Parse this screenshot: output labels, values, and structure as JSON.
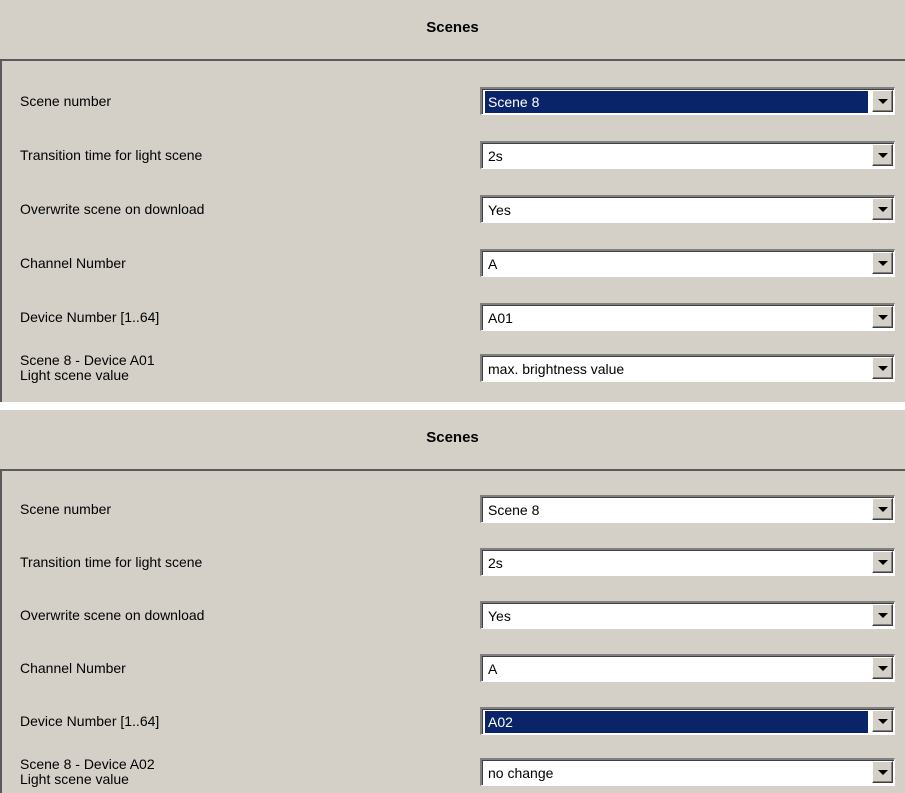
{
  "panels": [
    {
      "title": "Scenes",
      "rows": [
        {
          "label": "Scene number",
          "value": "Scene 8",
          "selected": true
        },
        {
          "label": "Transition time for light scene",
          "value": "2s",
          "selected": false
        },
        {
          "label": "Overwrite scene on download",
          "value": "Yes",
          "selected": false
        },
        {
          "label": "Channel Number",
          "value": "A",
          "selected": false
        },
        {
          "label": "Device Number [1..64]",
          "value": "A01",
          "selected": false
        },
        {
          "label": "Scene 8 - Device A01\nLight scene value",
          "value": "max. brightness value",
          "selected": false
        }
      ]
    },
    {
      "title": "Scenes",
      "rows": [
        {
          "label": "Scene number",
          "value": "Scene 8",
          "selected": false
        },
        {
          "label": "Transition time for light scene",
          "value": "2s",
          "selected": false
        },
        {
          "label": "Overwrite scene on download",
          "value": "Yes",
          "selected": false
        },
        {
          "label": "Channel Number",
          "value": "A",
          "selected": false
        },
        {
          "label": "Device Number [1..64]",
          "value": "A02",
          "selected": true
        },
        {
          "label": "Scene 8 - Device A02\nLight scene value",
          "value": "no change",
          "selected": false
        }
      ]
    }
  ],
  "icons": {
    "dropdown": "chevron-down-icon"
  },
  "colors": {
    "panel_bg": "#d4d0c8",
    "selection_bg": "#0a246a",
    "selection_text": "#ffffff"
  }
}
